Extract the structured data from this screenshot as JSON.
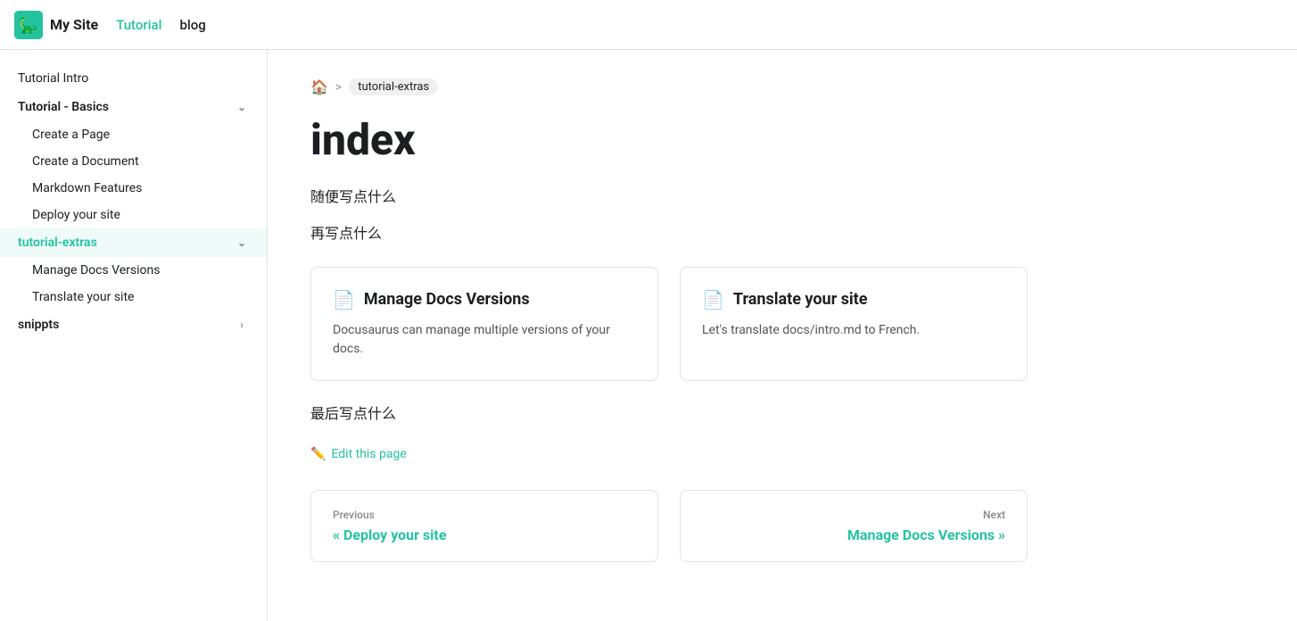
{
  "topnav": {
    "brand_icon_alt": "dinosaur-icon",
    "brand_label": "My Site",
    "links": [
      {
        "label": "Tutorial",
        "active": true,
        "color": "green"
      },
      {
        "label": "blog",
        "active": false
      }
    ]
  },
  "sidebar": {
    "items": [
      {
        "id": "tutorial-intro",
        "label": "Tutorial Intro",
        "type": "item",
        "indent": 0
      },
      {
        "id": "tutorial-basics",
        "label": "Tutorial - Basics",
        "type": "group",
        "indent": 0,
        "expanded": true,
        "chevron": "down"
      },
      {
        "id": "create-page",
        "label": "Create a Page",
        "type": "subitem",
        "indent": 1
      },
      {
        "id": "create-document",
        "label": "Create a Document",
        "type": "subitem",
        "indent": 1
      },
      {
        "id": "markdown-features",
        "label": "Markdown Features",
        "type": "subitem",
        "indent": 1
      },
      {
        "id": "deploy-your-site",
        "label": "Deploy your site",
        "type": "subitem",
        "indent": 1
      },
      {
        "id": "tutorial-extras",
        "label": "tutorial-extras",
        "type": "group",
        "indent": 0,
        "expanded": true,
        "active": true,
        "chevron": "down"
      },
      {
        "id": "manage-docs-versions",
        "label": "Manage Docs Versions",
        "type": "subitem",
        "indent": 1
      },
      {
        "id": "translate-your-site",
        "label": "Translate your site",
        "type": "subitem",
        "indent": 1
      },
      {
        "id": "snippts",
        "label": "snippts",
        "type": "group",
        "indent": 0,
        "expanded": false,
        "chevron": "right"
      }
    ]
  },
  "breadcrumb": {
    "home_icon": "🏠",
    "separator": ">",
    "current": "tutorial-extras"
  },
  "main": {
    "title": "index",
    "text1": "随便写点什么",
    "text2": "再写点什么",
    "text3": "最后写点什么",
    "edit_link": "Edit this page",
    "cards": [
      {
        "id": "manage-docs-versions-card",
        "icon": "📄",
        "title": "Manage Docs Versions",
        "description": "Docusaurus can manage multiple versions of your docs."
      },
      {
        "id": "translate-your-site-card",
        "icon": "📄",
        "title": "Translate your site",
        "description": "Let's translate docs/intro.md to French."
      }
    ],
    "prev_next": {
      "prev_label": "Previous",
      "prev_title": "« Deploy your site",
      "next_label": "Next",
      "next_title": "Manage Docs Versions »"
    }
  }
}
